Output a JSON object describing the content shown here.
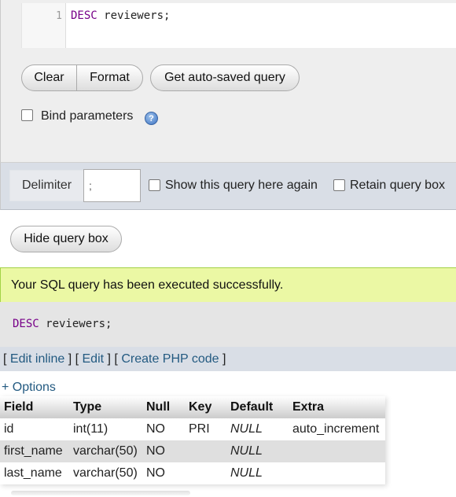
{
  "editor": {
    "line_number": "1",
    "keyword": "DESC",
    "rest": " reviewers;"
  },
  "buttons": {
    "clear": "Clear",
    "format": "Format",
    "autosaved": "Get auto-saved query",
    "hide_query_box": "Hide query box"
  },
  "bind_parameters": {
    "label": "Bind parameters",
    "checked": false
  },
  "delimiter": {
    "label": "Delimiter",
    "value": ";"
  },
  "options": {
    "show_again": "Show this query here again",
    "retain_box": "Retain query box"
  },
  "result": {
    "message": "Your SQL query has been executed successfully.",
    "sql_keyword": "DESC",
    "sql_rest": " reviewers;"
  },
  "links": {
    "edit_inline": "Edit inline",
    "edit": "Edit",
    "create_php": "Create PHP code"
  },
  "table_options": "+ Options",
  "table": {
    "headers": [
      "Field",
      "Type",
      "Null",
      "Key",
      "Default",
      "Extra"
    ],
    "rows": [
      [
        "id",
        "int(11)",
        "NO",
        "PRI",
        "NULL",
        "auto_increment"
      ],
      [
        "first_name",
        "varchar(50)",
        "NO",
        "",
        "NULL",
        ""
      ],
      [
        "last_name",
        "varchar(50)",
        "NO",
        "",
        "NULL",
        ""
      ]
    ]
  },
  "colors": {
    "link": "#235a81",
    "keyword": "#770088",
    "success_bg": "#ebf8a4",
    "success_border": "#a2d246"
  }
}
